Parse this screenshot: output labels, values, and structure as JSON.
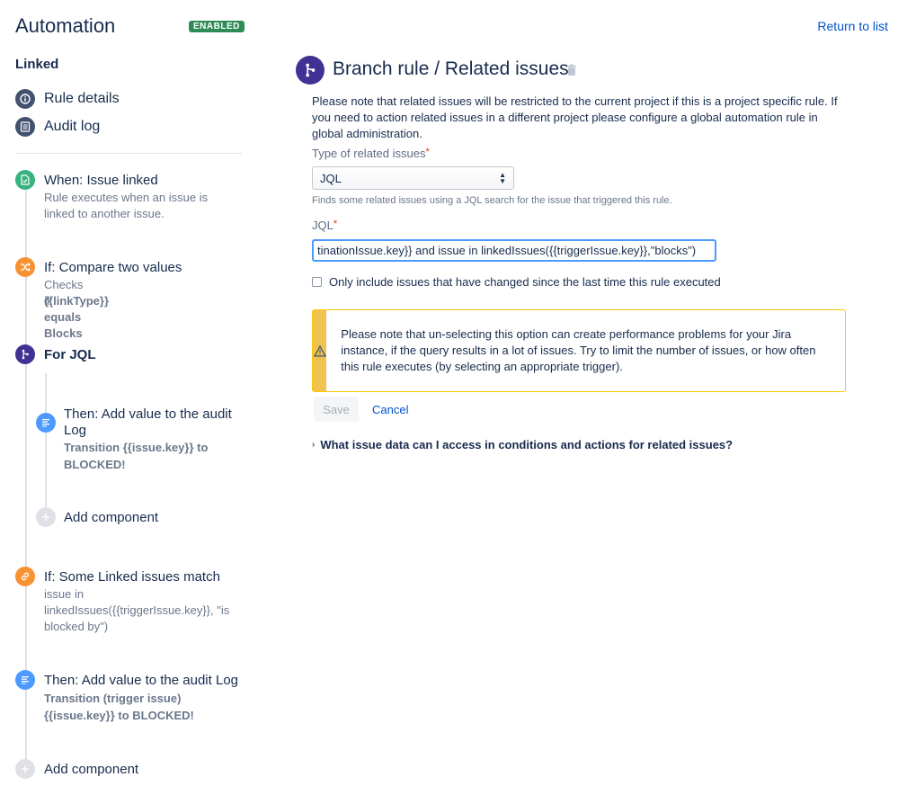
{
  "app": {
    "title": "Automation",
    "status_badge": "ENABLED",
    "rule_name": "Linked",
    "return_link": "Return to list"
  },
  "nav": {
    "rule_details": "Rule details",
    "audit_log": "Audit log"
  },
  "components": [
    {
      "title": "When: Issue linked",
      "desc": "Rule executes when an issue is linked to another issue.",
      "color": "#36b37e",
      "icon": "linked-trigger-icon"
    },
    {
      "title": "If: Compare two values",
      "desc1": "Checks if:",
      "desc2": "{{linkType}} equals Blocks",
      "color": "#ff8b00",
      "icon": "shuffle-icon"
    },
    {
      "title": "For JQL",
      "color": "#403294",
      "icon": "branch-icon"
    },
    {
      "title": "Then: Add value to the audit Log",
      "desc": "Transition {{issue.key}} to BLOCKED!",
      "color": "#4c9aff",
      "icon": "log-icon"
    },
    {
      "title": "Add component",
      "color": "#dfe1e6",
      "icon": "plus-icon"
    },
    {
      "title": "If: Some Linked issues match",
      "desc": "issue in linkedIssues({{triggerIssue.key}}, \"is blocked by\")",
      "color": "#ff991f",
      "icon": "link-icon"
    },
    {
      "title": "Then: Add value to the audit Log",
      "desc": "Transition (trigger issue) {{issue.key}} to BLOCKED!",
      "color": "#4c9aff",
      "icon": "log-icon"
    },
    {
      "title": "Add component",
      "color": "#dfe1e6",
      "icon": "plus-icon"
    }
  ],
  "main": {
    "title": "Branch rule / Related issues",
    "note": "Please note that related issues will be restricted to the current project if this is a project specific rule. If you need to action related issues in a different project please configure a global automation rule in global administration.",
    "type_label": "Type of related issues",
    "type_value": "JQL",
    "type_hint": "Finds some related issues using a JQL search for the issue that triggered this rule.",
    "jql_label": "JQL",
    "jql_value": "tinationIssue.key}} and issue in linkedIssues({{triggerIssue.key}},\"blocks\")",
    "checkbox_label": "Only include issues that have changed since the last time this rule executed",
    "warning": "Please note that un-selecting this option can create performance problems for your Jira instance, if the query results in a lot of issues. Try to limit the number of issues, or how often this rule executes (by selecting an appropriate trigger).",
    "save": "Save",
    "cancel": "Cancel",
    "expander": "What issue data can I access in conditions and actions for related issues?"
  }
}
